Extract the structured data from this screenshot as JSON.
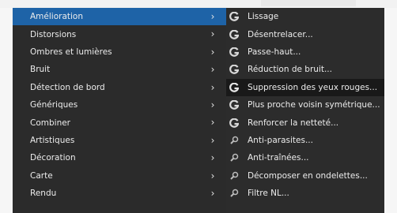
{
  "left_menu": {
    "items": [
      {
        "label": "Amélioration",
        "active": true
      },
      {
        "label": "Distorsions"
      },
      {
        "label": "Ombres et lumières"
      },
      {
        "label": "Bruit"
      },
      {
        "label": "Détection de bord"
      },
      {
        "label": "Génériques"
      },
      {
        "label": "Combiner"
      },
      {
        "label": "Artistiques"
      },
      {
        "label": "Décoration"
      },
      {
        "label": "Carte"
      },
      {
        "label": "Rendu"
      }
    ],
    "chevron": "›"
  },
  "submenu": {
    "items": [
      {
        "label": "Lissage",
        "icon": "gegl-icon"
      },
      {
        "label": "Désentrelacer...",
        "icon": "gegl-icon"
      },
      {
        "label": "Passe-haut...",
        "icon": "gegl-icon"
      },
      {
        "label": "Réduction de bruit...",
        "icon": "gegl-icon"
      },
      {
        "label": "Suppression des yeux rouges...",
        "icon": "gegl-icon",
        "active": true
      },
      {
        "label": "Plus proche voisin symétrique...",
        "icon": "gegl-icon"
      },
      {
        "label": "Renforcer la netteté...",
        "icon": "gegl-icon"
      },
      {
        "label": "Anti-parasites...",
        "icon": "script-fu-icon"
      },
      {
        "label": "Anti-traînées...",
        "icon": "script-fu-icon"
      },
      {
        "label": "Décomposer en ondelettes...",
        "icon": "script-fu-icon"
      },
      {
        "label": "Filtre NL...",
        "icon": "script-fu-icon"
      }
    ]
  },
  "colors": {
    "menu_bg": "#2b2b2b",
    "active_left": "#1e63a7",
    "active_right": "#191919",
    "text": "#ececec"
  }
}
